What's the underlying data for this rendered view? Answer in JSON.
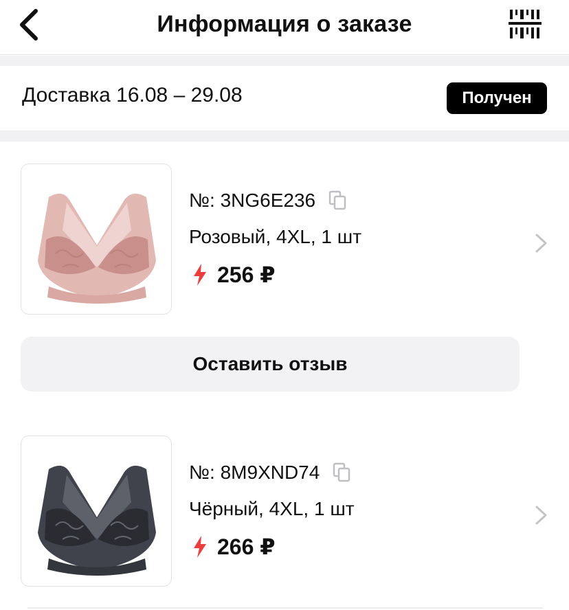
{
  "header": {
    "title": "Информация о заказе",
    "back_icon": "chevron-left-icon",
    "barcode_icon": "barcode-icon"
  },
  "delivery": {
    "text": "Доставка 16.08 – 29.08",
    "status": "Получен"
  },
  "items": [
    {
      "sku": "№: 3NG6E236",
      "variant": "Розовый, 4XL, 1 шт",
      "price": "256 ₽",
      "image": "pink-lace-bra",
      "image_color": "#d9a8a3"
    },
    {
      "sku": "№: 8M9XND74",
      "variant": "Чёрный, 4XL, 1 шт",
      "price": "266 ₽",
      "image": "black-lace-bra",
      "image_color": "#3a3d45"
    }
  ],
  "review_button": "Оставить отзыв",
  "colors": {
    "accent_bolt": "#ee3b3b",
    "badge_bg": "#000000",
    "button_bg": "#f2f2f4"
  }
}
